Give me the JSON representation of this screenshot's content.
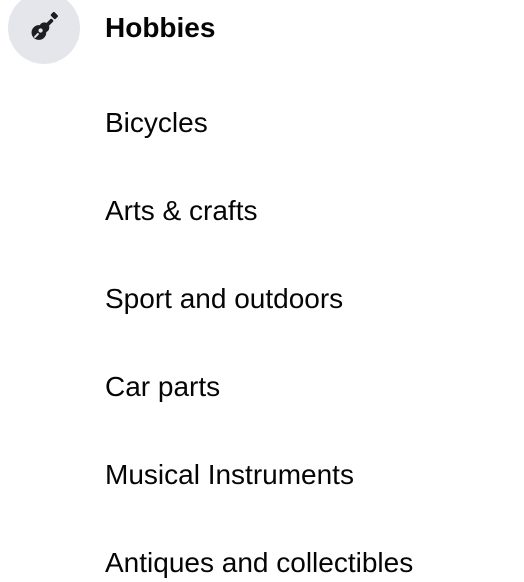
{
  "category": {
    "icon": "guitar-icon",
    "title": "Hobbies",
    "icon_background": "#e4e6eb",
    "icon_color": "#1c1e21"
  },
  "subcategories": [
    {
      "label": "Bicycles"
    },
    {
      "label": "Arts & crafts"
    },
    {
      "label": "Sport and outdoors"
    },
    {
      "label": "Car parts"
    },
    {
      "label": "Musical Instruments"
    },
    {
      "label": "Antiques and collectibles"
    }
  ]
}
